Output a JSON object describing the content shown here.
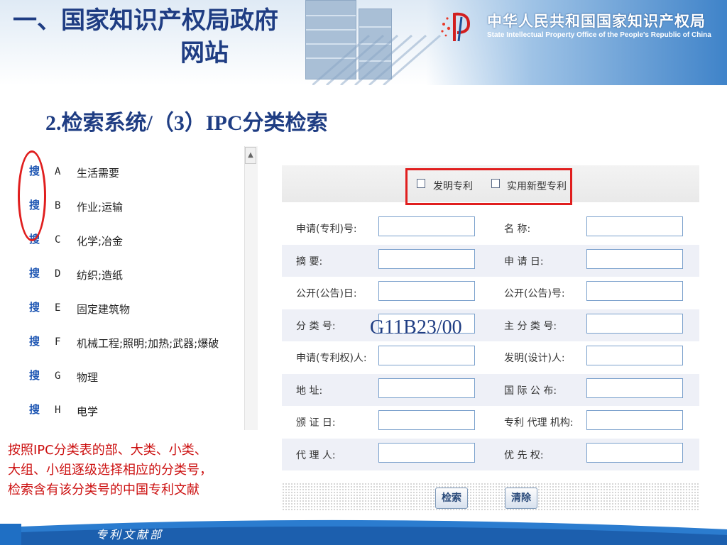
{
  "slide": {
    "title_line1": "一、国家知识产权局政府",
    "title_line2": "网站",
    "subtitle": "2.检索系统/（3）IPC分类检索",
    "org_name_cn": "中华人民共和国国家知识产权局",
    "org_name_en": "State Intellectual Property Office of the People's Republic of China",
    "footer": "专利文献部",
    "note_lines": [
      "按照IPC分类表的部、大类、小类、",
      "大组、小组逐级选择相应的分类号，",
      "检索含有该分类号的中国专利文献"
    ],
    "ipc_overlay": "G11B23/00"
  },
  "ipc_sections": [
    {
      "search": "搜",
      "code": "A",
      "name": "生活需要"
    },
    {
      "search": "搜",
      "code": "B",
      "name": "作业;运输"
    },
    {
      "search": "搜",
      "code": "C",
      "name": "化学;冶金"
    },
    {
      "search": "搜",
      "code": "D",
      "name": "纺织;造纸"
    },
    {
      "search": "搜",
      "code": "E",
      "name": "固定建筑物"
    },
    {
      "search": "搜",
      "code": "F",
      "name": "机械工程;照明;加热;武器;爆破"
    },
    {
      "search": "搜",
      "code": "G",
      "name": "物理"
    },
    {
      "search": "搜",
      "code": "H",
      "name": "电学"
    }
  ],
  "form": {
    "checkboxes": [
      {
        "label": "发明专利",
        "checked": false
      },
      {
        "label": "实用新型专利",
        "checked": false
      }
    ],
    "rows": [
      {
        "left_label": "申请(专利)号:",
        "left_value": "",
        "right_label": "名        称:",
        "right_value": ""
      },
      {
        "left_label": "摘        要:",
        "left_value": "",
        "right_label": "申   请   日:",
        "right_value": ""
      },
      {
        "left_label": "公开(公告)日:",
        "left_value": "",
        "right_label": "公开(公告)号:",
        "right_value": ""
      },
      {
        "left_label": "分   类   号:",
        "left_value": "",
        "right_label": "主 分 类 号:",
        "right_value": ""
      },
      {
        "left_label": "申请(专利权)人:",
        "left_value": "",
        "right_label": "发明(设计)人:",
        "right_value": ""
      },
      {
        "left_label": "地         址:",
        "left_value": "",
        "right_label": "国 际 公 布:",
        "right_value": ""
      },
      {
        "left_label": "颁   证   日:",
        "left_value": "",
        "right_label": "专利 代理 机构:",
        "right_value": ""
      },
      {
        "left_label": "代   理   人:",
        "left_value": "",
        "right_label": "优   先   权:",
        "right_value": ""
      }
    ],
    "search_button": "检索",
    "clear_button": "清除"
  },
  "colors": {
    "title": "#1f3d83",
    "highlight": "#e01e1e",
    "note": "#cc1010",
    "input_border": "#7aa0cc"
  }
}
